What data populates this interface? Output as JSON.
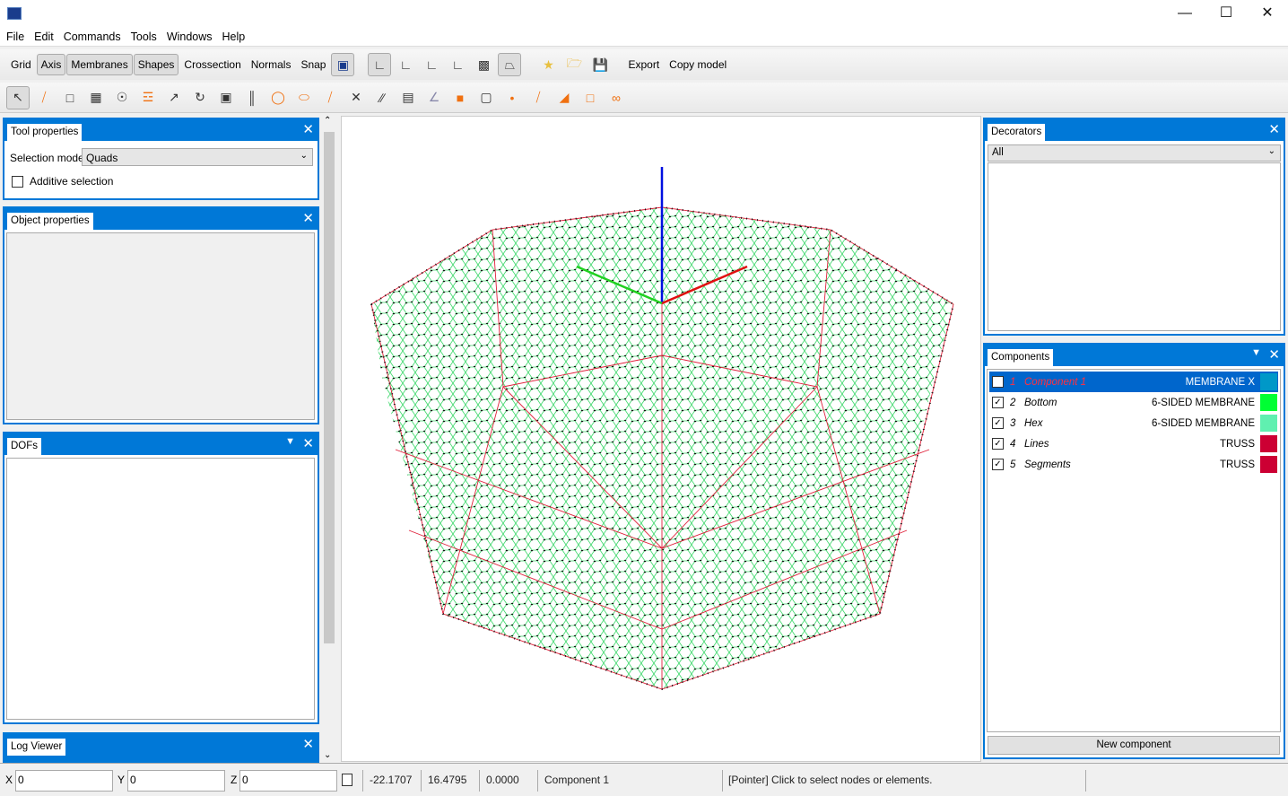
{
  "menu": [
    "File",
    "Edit",
    "Commands",
    "Tools",
    "Windows",
    "Help"
  ],
  "toolbar1": {
    "text_buttons": [
      {
        "label": "Grid",
        "on": false
      },
      {
        "label": "Axis",
        "on": true
      },
      {
        "label": "Membranes",
        "on": true
      },
      {
        "label": "Shapes",
        "on": true
      },
      {
        "label": "Crossection",
        "on": false
      },
      {
        "label": "Normals",
        "on": false
      },
      {
        "label": "Snap",
        "on": false
      }
    ],
    "export": "Export",
    "copy_model": "Copy model"
  },
  "left": {
    "tool_properties": {
      "title": "Tool properties",
      "selection_model_label": "Selection model",
      "selection_model_value": "Quads",
      "additive_selection": "Additive selection"
    },
    "object_properties": {
      "title": "Object properties"
    },
    "dofs": {
      "title": "DOFs"
    },
    "log_viewer": {
      "title": "Log Viewer"
    }
  },
  "decorators": {
    "title": "Decorators",
    "filter": "All"
  },
  "components": {
    "title": "Components",
    "new_button": "New component",
    "items": [
      {
        "num": "1",
        "name": "Component 1",
        "type": "MEMBRANE X",
        "color": "#0098c8",
        "checked": false,
        "selected": true
      },
      {
        "num": "2",
        "name": "Bottom",
        "type": "6-SIDED MEMBRANE",
        "color": "#00ff33",
        "checked": true,
        "selected": false
      },
      {
        "num": "3",
        "name": "Hex",
        "type": "6-SIDED MEMBRANE",
        "color": "#60f0b0",
        "checked": true,
        "selected": false
      },
      {
        "num": "4",
        "name": "Lines",
        "type": "TRUSS",
        "color": "#cc0033",
        "checked": true,
        "selected": false
      },
      {
        "num": "5",
        "name": "Segments",
        "type": "TRUSS",
        "color": "#cc0033",
        "checked": true,
        "selected": false
      }
    ]
  },
  "status": {
    "x_label": "X",
    "x": "0",
    "y_label": "Y",
    "y": "0",
    "z_label": "Z",
    "z": "0",
    "cx": "-22.1707",
    "cy": "16.4795",
    "cz": "0.0000",
    "component": "Component 1",
    "message": "[Pointer] Click to select nodes or elements."
  }
}
